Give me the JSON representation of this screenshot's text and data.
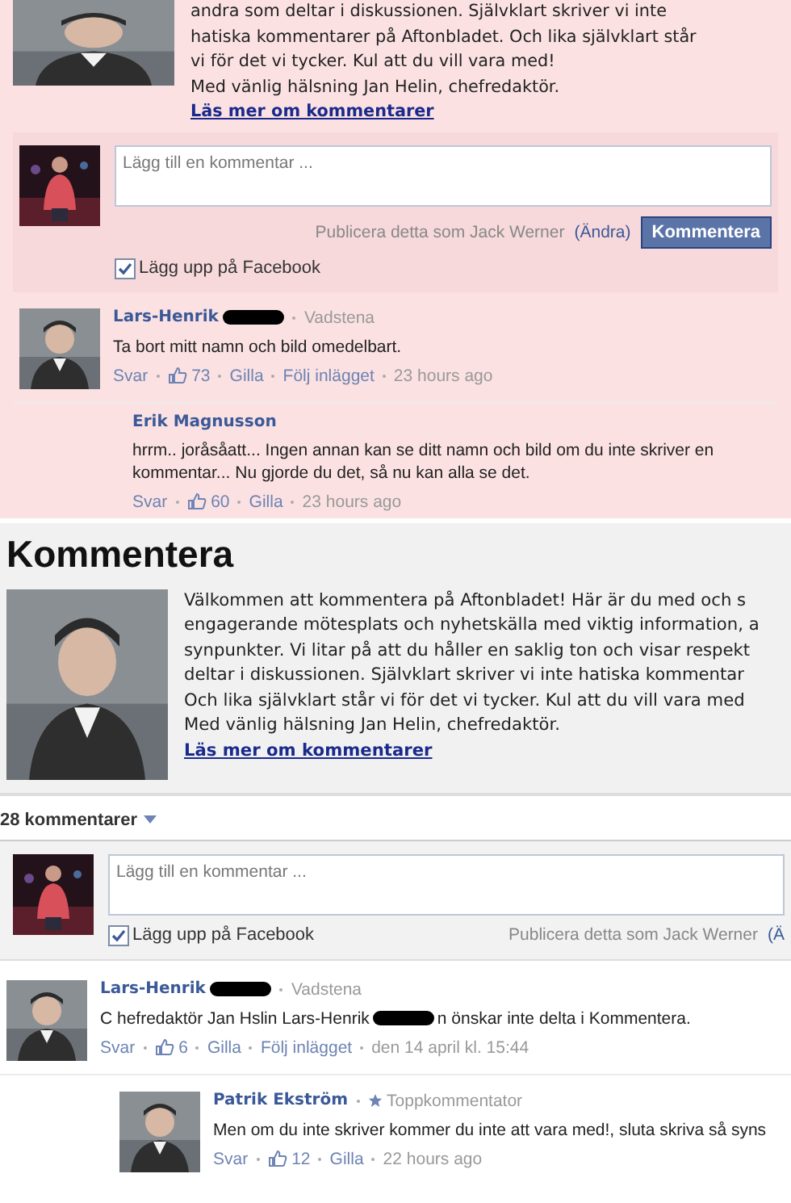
{
  "upper_panel": {
    "intro": {
      "lines": [
        "andra som deltar i diskussionen. Självklart skriver vi inte",
        "hatiska kommentarer på Aftonbladet. Och lika självklart står",
        "vi för det vi tycker. Kul att du vill vara med!",
        "Med vänlig hälsning Jan Helin, chefredaktör."
      ],
      "link": "Läs mer om kommentarer"
    },
    "composer": {
      "placeholder": "Lägg till en kommentar ...",
      "publish_as": "Publicera detta som Jack Werner",
      "change_link": "(Ändra)",
      "button": "Kommentera",
      "share_label": "Lägg upp på Facebook",
      "share_checked": true
    },
    "comments": [
      {
        "kind": "top",
        "has_avatar": true,
        "author": "Lars-Henrik",
        "redacted_name": true,
        "meta": "Vadstena",
        "text_parts": [
          "Ta bort mitt namn och bild omedelbart."
        ],
        "reply": "Svar",
        "likes": "73",
        "like": "Gilla",
        "follow": "Följ inlägget",
        "time": "23 hours ago"
      },
      {
        "kind": "reply",
        "has_avatar": false,
        "author": "Erik Magnusson",
        "redacted_name": false,
        "text_parts": [
          "hrrm.. joråsåatt... Ingen annan kan se ditt namn och bild om du inte skriver en kommentar... Nu gjorde du det, så nu kan alla se det."
        ],
        "reply": "Svar",
        "likes": "60",
        "like": "Gilla",
        "time": "23 hours ago"
      }
    ]
  },
  "lower_panel": {
    "heading": "Kommentera",
    "intro": {
      "lines": [
        "Välkommen att kommentera på Aftonbladet! Här är du med och s",
        "engagerande mötesplats och nyhetskälla med viktig information, a",
        "synpunkter. Vi litar på att du håller en saklig ton och visar respekt",
        "deltar i diskussionen. Självklart skriver vi inte hatiska kommentar",
        "Och lika självklart står vi för det vi tycker. Kul att du vill vara med",
        "Med vänlig hälsning Jan Helin, chefredaktör."
      ],
      "link": "Läs mer om kommentarer"
    },
    "comment_count": "28 kommentarer",
    "composer": {
      "placeholder": "Lägg till en kommentar ...",
      "publish_as": "Publicera detta som Jack Werner",
      "change_link": "(Ä",
      "share_label": "Lägg upp på Facebook",
      "share_checked": true
    },
    "comments": [
      {
        "kind": "top",
        "has_avatar": true,
        "author": "Lars-Henrik",
        "redacted_name": true,
        "meta": "Vadstena",
        "text_parts": [
          "C hefredaktör Jan Hslin Lars-Henrik",
          "n önskar inte delta i Kommentera."
        ],
        "reply": "Svar",
        "likes": "6",
        "like": "Gilla",
        "follow": "Följ inlägget",
        "time": "den 14 april kl. 15:44"
      },
      {
        "kind": "reply",
        "has_avatar": true,
        "author": "Patrik Ekström",
        "redacted_name": false,
        "badge": "Toppkommentator",
        "text_parts": [
          "Men om du inte skriver kommer du inte att vara med!, sluta skriva så syns"
        ],
        "reply": "Svar",
        "likes": "12",
        "like": "Gilla",
        "time": "22 hours ago"
      }
    ]
  }
}
